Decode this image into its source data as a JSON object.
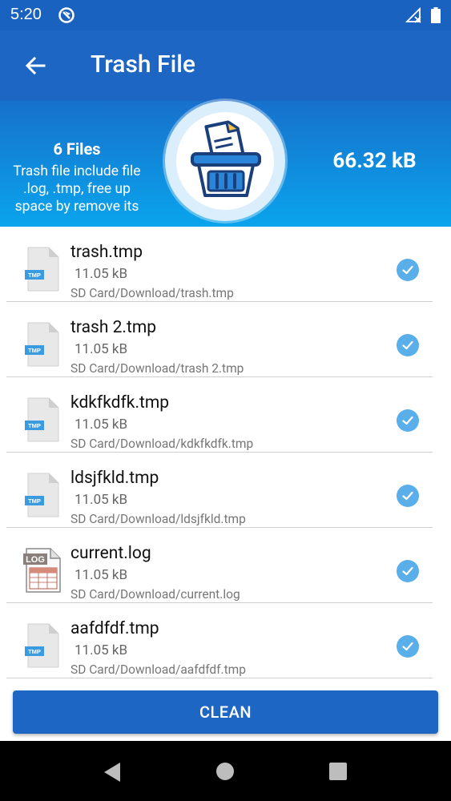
{
  "status_bar": {
    "time": "5:20"
  },
  "app_bar": {
    "title": "Trash File"
  },
  "banner": {
    "files_count": "6 Files",
    "description": "Trash file include file .log, .tmp, free up space by remove its",
    "total_size": "66.32 kB"
  },
  "files": [
    {
      "name": "trash.tmp",
      "size": "11.05 kB",
      "path": "SD Card/Download/trash.tmp",
      "type": "TMP"
    },
    {
      "name": "trash 2.tmp",
      "size": "11.05 kB",
      "path": "SD Card/Download/trash 2.tmp",
      "type": "TMP"
    },
    {
      "name": "kdkfkdfk.tmp",
      "size": "11.05 kB",
      "path": "SD Card/Download/kdkfkdfk.tmp",
      "type": "TMP"
    },
    {
      "name": "ldsjfkld.tmp",
      "size": "11.05 kB",
      "path": "SD Card/Download/ldsjfkld.tmp",
      "type": "TMP"
    },
    {
      "name": "current.log",
      "size": "11.05 kB",
      "path": "SD Card/Download/current.log",
      "type": "LOG"
    },
    {
      "name": "aafdfdf.tmp",
      "size": "11.05 kB",
      "path": "SD Card/Download/aafdfdf.tmp",
      "type": "TMP"
    }
  ],
  "clean_button": {
    "label": "CLEAN"
  },
  "colors": {
    "primary": "#1e66c4",
    "accent": "#5aaeea",
    "banner_top": "#1771cc",
    "banner_bottom": "#0aa4ec"
  }
}
